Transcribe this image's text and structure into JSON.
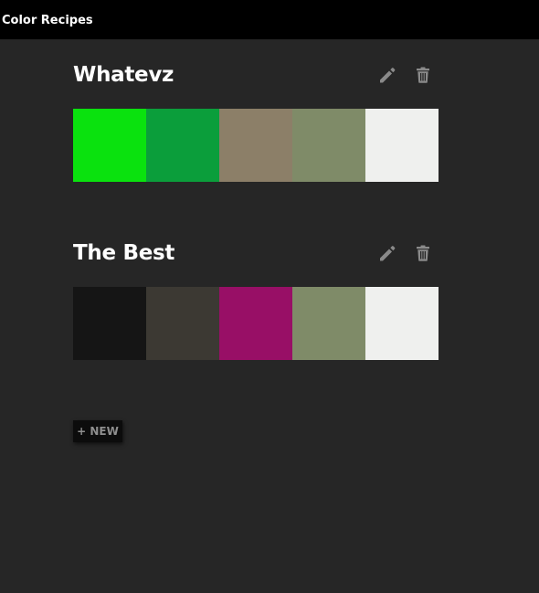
{
  "header": {
    "app_title": "Color Recipes"
  },
  "recipes": [
    {
      "name": "Whatevz",
      "swatches": [
        "#0ae20e",
        "#0b9e3b",
        "#8c7f68",
        "#7f8b68",
        "#eff0ee"
      ]
    },
    {
      "name": "The Best",
      "swatches": [
        "#151515",
        "#3c3933",
        "#980f66",
        "#7f8b68",
        "#eff0ee"
      ]
    }
  ],
  "icons": {
    "edit": "pencil-icon",
    "delete": "trash-icon"
  },
  "actions": {
    "new_label": "+ NEW"
  },
  "colors": {
    "background": "#262626",
    "topbar": "#000000",
    "icon": "#8a8a8a"
  }
}
